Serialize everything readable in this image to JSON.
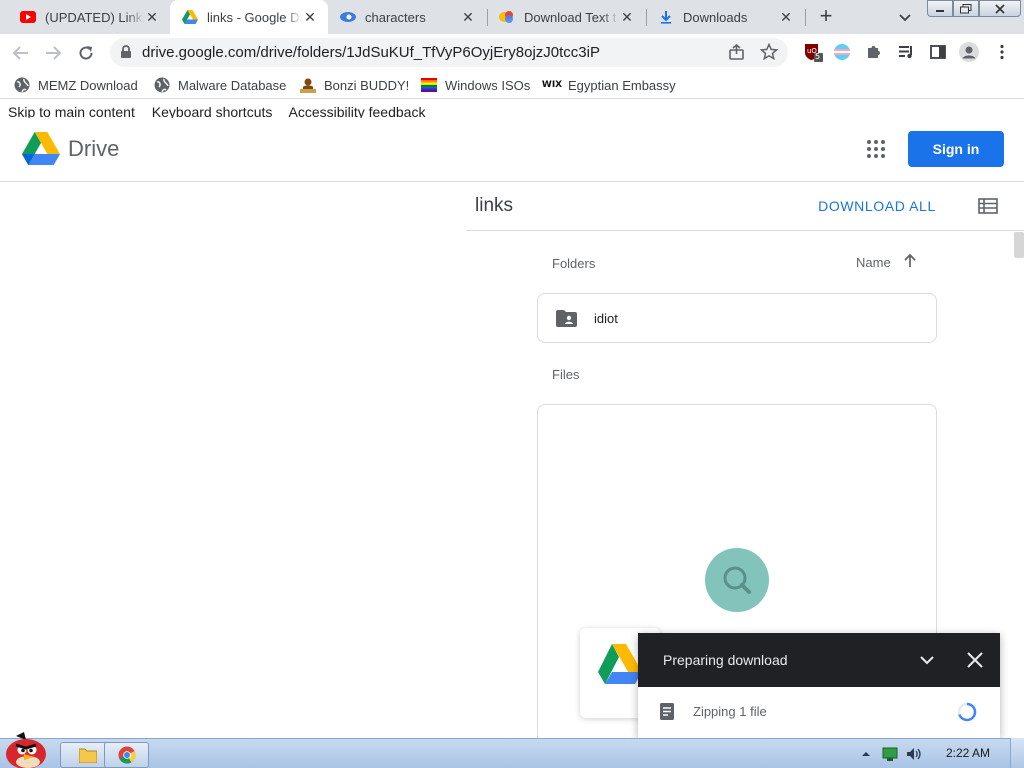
{
  "tabs": [
    {
      "title": "(UPDATED) Links",
      "icon": "youtube-icon"
    },
    {
      "title": "links - Google Drive",
      "icon": "google-drive-icon",
      "active": true
    },
    {
      "title": "characters",
      "icon": "wix-eye-icon"
    },
    {
      "title": "Download Text t",
      "icon": "colorful-logo-icon"
    },
    {
      "title": "Downloads",
      "icon": "download-icon"
    }
  ],
  "address_bar": {
    "url": "drive.google.com/drive/folders/1JdSuKUf_TfVyP6OyjEry8ojzJ0tcc3iP"
  },
  "extensions": {
    "ublock_badge": "5"
  },
  "bookmarks": [
    {
      "label": "MEMZ Download",
      "icon": "globe-icon"
    },
    {
      "label": "Malware Database",
      "icon": "globe-icon"
    },
    {
      "label": "Bonzi BUDDY!",
      "icon": "bonzi-icon"
    },
    {
      "label": "Windows ISOs",
      "icon": "rainbow-flag-icon"
    },
    {
      "label": "Egyptian Embassy",
      "icon": "wix-icon"
    }
  ],
  "skip_links": [
    "Skip to main content",
    "Keyboard shortcuts",
    "Accessibility feedback"
  ],
  "drive": {
    "brand": "Drive",
    "sign_in": "Sign in",
    "folder_title": "links",
    "download_all": "DOWNLOAD ALL",
    "folders_label": "Folders",
    "sort_label": "Name",
    "folders": [
      {
        "name": "idiot"
      }
    ],
    "files_label": "Files"
  },
  "download_panel": {
    "title": "Preparing download",
    "item": "Zipping 1 file"
  },
  "taskbar": {
    "clock": "2:22 AM"
  },
  "colors": {
    "accent": "#1a73e8",
    "panel_header": "#202124",
    "magnifier": "#82c4bc"
  }
}
